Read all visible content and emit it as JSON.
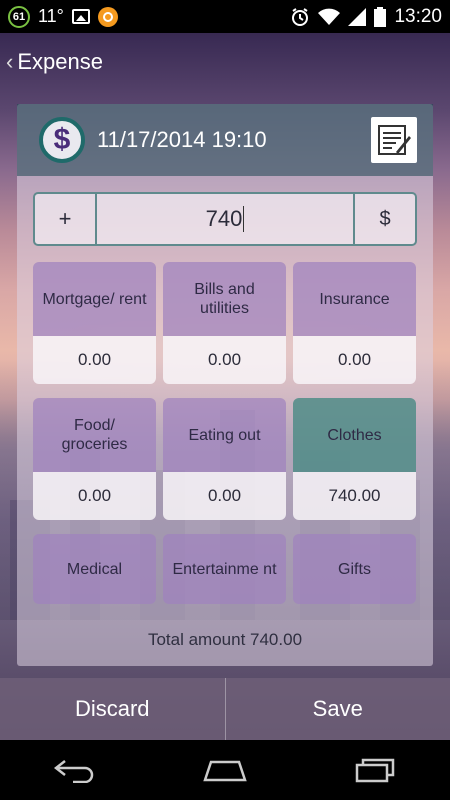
{
  "status_bar": {
    "battery_level": "61",
    "temperature": "11°",
    "time": "13:20"
  },
  "action_bar": {
    "title": "Expense"
  },
  "header": {
    "currency_symbol": "$",
    "datetime": "11/17/2014 19:10"
  },
  "amount": {
    "sign_label": "+",
    "value": "740",
    "currency_label": "$"
  },
  "categories": [
    {
      "label": "Mortgage/ rent",
      "value": "0.00"
    },
    {
      "label": "Bills and utilities",
      "value": "0.00"
    },
    {
      "label": "Insurance",
      "value": "0.00"
    },
    {
      "label": "Food/ groceries",
      "value": "0.00"
    },
    {
      "label": "Eating out",
      "value": "0.00"
    },
    {
      "label": "Clothes",
      "value": "740.00",
      "selected": true
    },
    {
      "label": "Medical"
    },
    {
      "label": "Entertainme nt"
    },
    {
      "label": "Gifts"
    }
  ],
  "total": "Total amount 740.00",
  "buttons": {
    "discard": "Discard",
    "save": "Save"
  },
  "icons": {
    "back": "chevron-left-icon",
    "note": "note-edit-icon",
    "nav_back": "back-arrow-icon",
    "nav_home": "home-icon",
    "nav_recents": "recents-icon"
  },
  "colors": {
    "accent_teal": "#1f6a6a",
    "selected_tile": "#508c87",
    "tile_purple": "#a082be"
  }
}
